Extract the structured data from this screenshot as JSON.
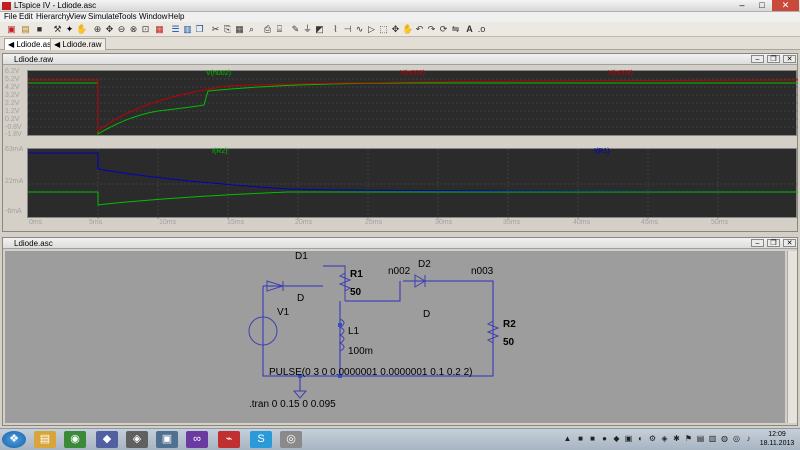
{
  "window": {
    "title": "LTspice IV - Ldiode.asc",
    "min": "–",
    "max": "□",
    "close": "✕"
  },
  "menu": [
    "File",
    "Edit",
    "Hierarchy",
    "View",
    "Simulate",
    "Tools",
    "Window",
    "Help"
  ],
  "tabs": [
    "Ldiode.asc",
    "Ldiode.raw"
  ],
  "waveform": {
    "title": "Ldiode.raw",
    "top": {
      "traces": [
        {
          "label": "V(n002)",
          "color": "#00c000"
        },
        {
          "label": "V(n003)",
          "color": "#c00000"
        },
        {
          "label": "V(n003)",
          "color": "#c00000"
        }
      ],
      "yticks": [
        "6.2V",
        "5.2V",
        "4.2V",
        "3.2V",
        "2.2V",
        "1.2V",
        "0.2V",
        "-0.8V",
        "-1.8V"
      ]
    },
    "bottom": {
      "traces": [
        {
          "label": "I(R2)",
          "color": "#00c000"
        },
        {
          "label": "I(R1)",
          "color": "#0000c0"
        }
      ],
      "yticks": [
        "63mA",
        "22mA",
        "-6mA"
      ]
    },
    "xticks": [
      "0ms",
      "5ms",
      "10ms",
      "15ms",
      "20ms",
      "25ms",
      "30ms",
      "35ms",
      "40ms",
      "45ms",
      "50ms"
    ]
  },
  "schematic": {
    "title": "Ldiode.asc",
    "labels": {
      "d1": "D1",
      "d1_model": "D",
      "r1": "R1",
      "r1_val": "50",
      "n002": "n002",
      "d2": "D2",
      "d2_model": "D",
      "n003": "n003",
      "v1": "V1",
      "l1": "L1",
      "l1_val": "100m",
      "r2": "R2",
      "r2_val": "50",
      "pulse": "PULSE(0 3 0 0.0000001 0.0000001 0.1 0.2 2)",
      "tran": ".tran 0 0.15 0 0.095"
    }
  },
  "taskbar": {
    "clock_time": "12:09",
    "clock_date": "18.11.2013"
  },
  "colors": {
    "green": "#00c000",
    "red": "#c00000",
    "blue": "#0000c0",
    "plotbg": "#2b2b2b"
  }
}
